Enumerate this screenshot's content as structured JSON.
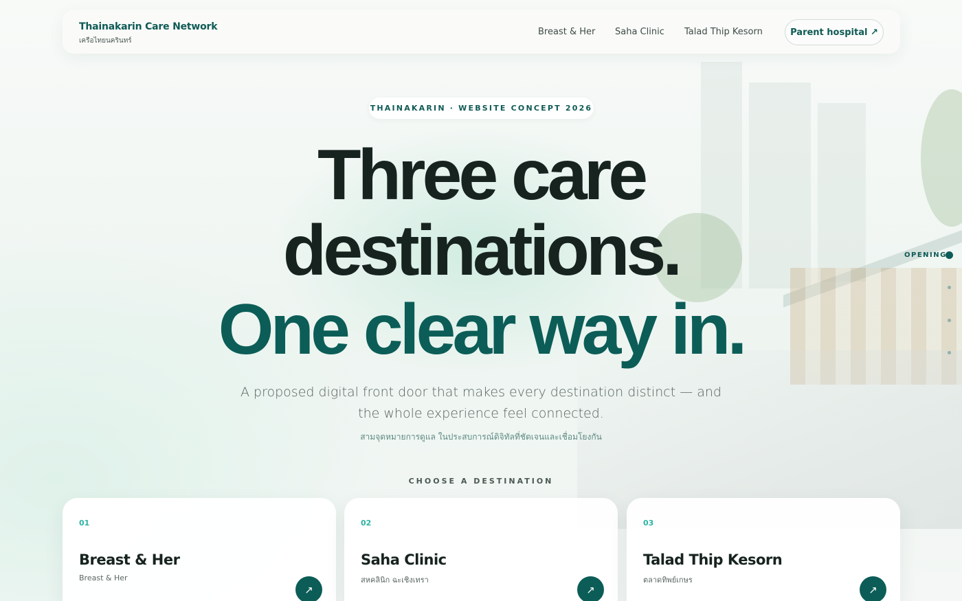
{
  "nav": {
    "brand_title": "Thainakarin Care Network",
    "brand_subtitle": "เครือไทยนครินทร์",
    "links": [
      "Breast & Her",
      "Saha Clinic",
      "Talad Thip Kesorn"
    ],
    "cta_label": "Parent hospital ↗"
  },
  "hero": {
    "eyebrow": "THAINAKARIN · WEBSITE CONCEPT 2026",
    "headline_line1": "Three care",
    "headline_line2": "destinations.",
    "headline_line3": "One clear way in.",
    "lead_line1": "A proposed digital front door that makes every destination distinct — and",
    "lead_line2": "the whole experience feel connected.",
    "lead_thai": "สามจุดหมายการดูแล ในประสบการณ์ดิจิทัลที่ชัดเจนและเชื่อมโยงกัน",
    "choose_label": "CHOOSE A DESTINATION"
  },
  "side_progress": {
    "active_label": "OPENING",
    "steps_total": 4,
    "active_step": 1
  },
  "cards": [
    {
      "num": "01",
      "title": "Breast & Her",
      "subtitle": "Breast & Her",
      "icon": "arrow-up-right-icon",
      "arrow": "↗"
    },
    {
      "num": "02",
      "title": "Saha Clinic",
      "subtitle": "สหคลินิก ฉะเชิงเทรา",
      "icon": "arrow-up-right-icon",
      "arrow": "↗"
    },
    {
      "num": "03",
      "title": "Talad Thip Kesorn",
      "subtitle": "ตลาดทิพย์เกษร",
      "icon": "arrow-up-right-icon",
      "arrow": "↗"
    }
  ],
  "colors": {
    "brand": "#0c5d57",
    "accent": "#2bb3a3",
    "ink": "#17231f"
  }
}
